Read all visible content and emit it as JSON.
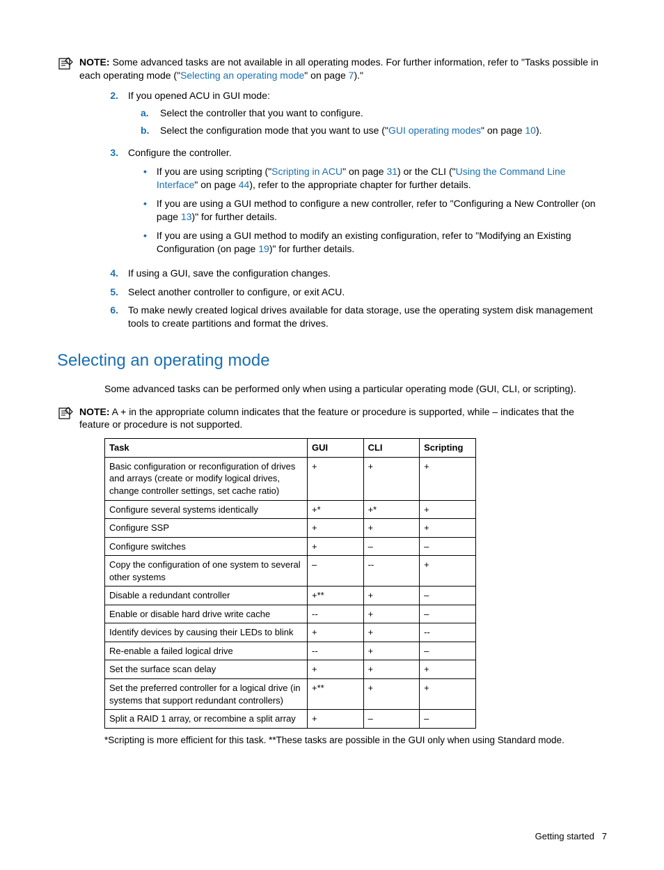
{
  "note1": {
    "label": "NOTE:",
    "text_part1": " Some advanced tasks are not available in all operating modes. For further information, refer to \"Tasks possible in each operating mode (\"",
    "link1": "Selecting an operating mode",
    "text_part2": "\" on page ",
    "link2": "7",
    "text_part3": ").\""
  },
  "step2": {
    "num": "2.",
    "text": "If you opened ACU in GUI mode:",
    "a_letter": "a.",
    "a_text": "Select the controller that you want to configure.",
    "b_letter": "b.",
    "b_pre": "Select the configuration mode that you want to use (\"",
    "b_link": "GUI operating modes",
    "b_mid": "\" on page ",
    "b_pg": "10",
    "b_post": ")."
  },
  "step3": {
    "num": "3.",
    "text": "Configure the controller.",
    "b1_pre": "If you are using scripting (\"",
    "b1_link1": "Scripting in ACU",
    "b1_mid1": "\" on page ",
    "b1_pg1": "31",
    "b1_mid2": ") or the CLI (\"",
    "b1_link2": "Using the Command Line Interface",
    "b1_mid3": "\" on page ",
    "b1_pg2": "44",
    "b1_post": "), refer to the appropriate chapter for further details.",
    "b2_pre": "If you are using a GUI method to configure a new controller, refer to \"Configuring a New Controller (on page ",
    "b2_pg": "13",
    "b2_post": ")\" for further details.",
    "b3_pre": "If you are using a GUI method to modify an existing configuration, refer to \"Modifying an Existing Configuration (on page ",
    "b3_pg": "19",
    "b3_post": ")\" for further details."
  },
  "step4": {
    "num": "4.",
    "text": "If using a GUI, save the configuration changes."
  },
  "step5": {
    "num": "5.",
    "text": "Select another controller to configure, or exit ACU."
  },
  "step6": {
    "num": "6.",
    "text": "To make newly created logical drives available for data storage, use the operating system disk management tools to create partitions and format the drives."
  },
  "heading": "Selecting an operating mode",
  "intro": "Some advanced tasks can be performed only when using a particular operating mode (GUI, CLI, or scripting).",
  "note2": {
    "label": "NOTE:",
    "text": "  A + in the appropriate column indicates that the feature or procedure is supported, while – indicates that the feature or procedure is not supported."
  },
  "chart_data": {
    "type": "table",
    "headers": [
      "Task",
      "GUI",
      "CLI",
      "Scripting"
    ],
    "rows": [
      [
        "Basic configuration or reconfiguration of drives and arrays (create or modify logical drives, change controller settings, set cache ratio)",
        "+",
        "+",
        "+"
      ],
      [
        "Configure several systems identically",
        "+*",
        "+*",
        "+"
      ],
      [
        "Configure SSP",
        "+",
        "+",
        "+"
      ],
      [
        "Configure switches",
        "+",
        "–",
        "–"
      ],
      [
        "Copy the configuration of one system to several other systems",
        "–",
        "--",
        "+"
      ],
      [
        "Disable a redundant controller",
        "+**",
        "+",
        "–"
      ],
      [
        "Enable or disable hard drive write cache",
        "--",
        "+",
        "–"
      ],
      [
        "Identify devices by causing their LEDs to blink",
        "+",
        "+",
        "--"
      ],
      [
        "Re-enable a failed logical drive",
        "--",
        "+",
        "–"
      ],
      [
        "Set the surface scan delay",
        "+",
        "+",
        "+"
      ],
      [
        "Set the preferred controller for a logical drive (in systems that support redundant controllers)",
        "+**",
        "+",
        "+"
      ],
      [
        "Split a RAID 1 array, or recombine a split array",
        "+",
        "–",
        "–"
      ]
    ]
  },
  "footnote": "*Scripting is more efficient for this task. **These tasks are possible in the GUI only when using Standard mode.",
  "footer": {
    "section": "Getting started",
    "page": "7"
  }
}
